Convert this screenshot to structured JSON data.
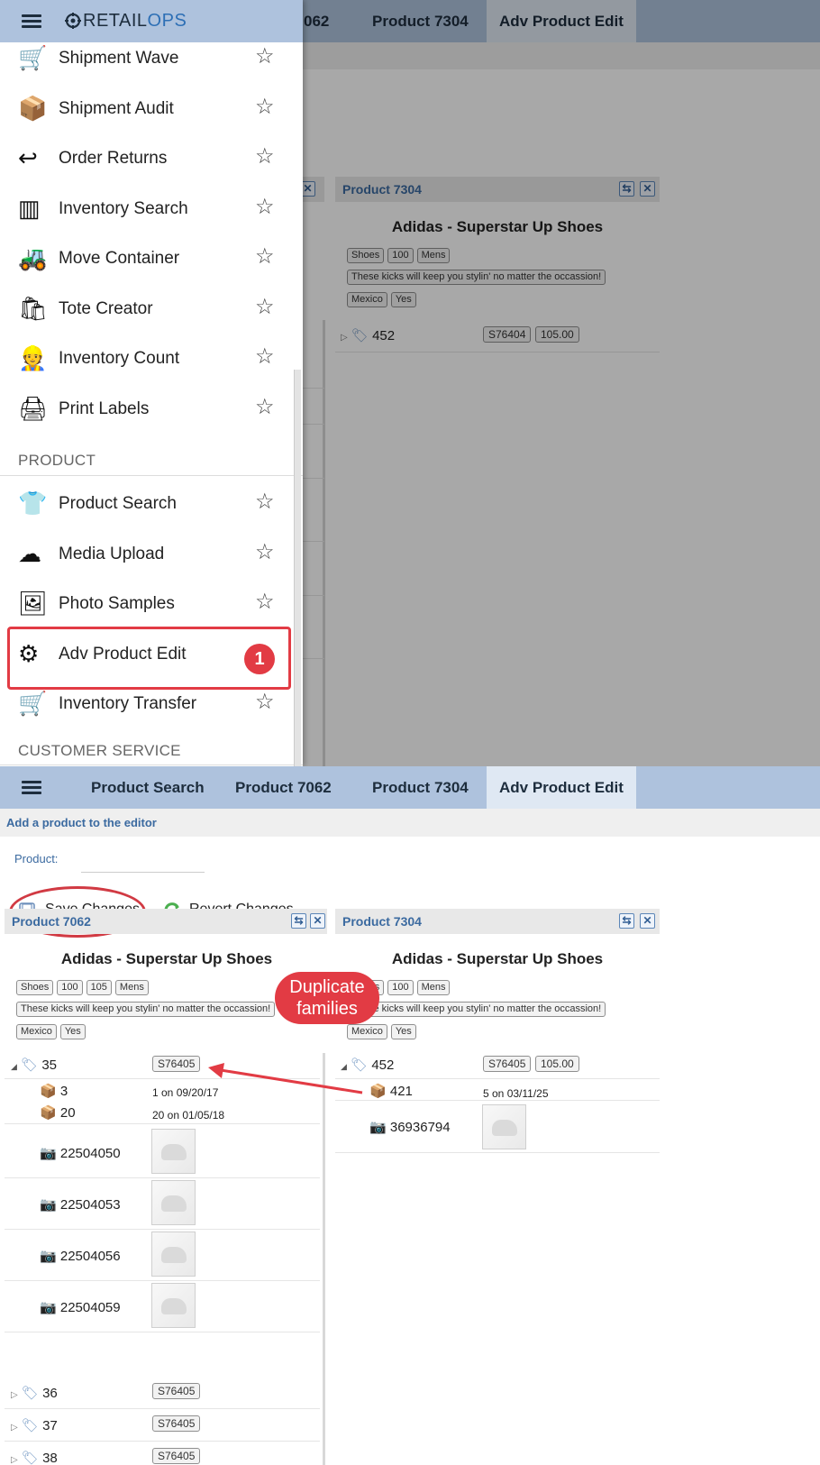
{
  "tabs": [
    "Product Search",
    "Product 7062",
    "Product 7304",
    "Adv Product Edit"
  ],
  "top_partial_tab": "062",
  "logo": {
    "left": "RETAIL",
    "right": "OPS"
  },
  "menu": {
    "items_a": [
      {
        "label": "Shipment Wave",
        "icon": "hand-truck-icon"
      },
      {
        "label": "Shipment Audit",
        "icon": "open-box-icon"
      },
      {
        "label": "Order Returns",
        "icon": "return-box-icon"
      },
      {
        "label": "Inventory Search",
        "icon": "barcode-search-icon"
      },
      {
        "label": "Move Container",
        "icon": "forklift-icon"
      },
      {
        "label": "Tote Creator",
        "icon": "shopping-bags-icon"
      },
      {
        "label": "Inventory Count",
        "icon": "counting-worker-icon"
      },
      {
        "label": "Print Labels",
        "icon": "printer-icon"
      }
    ],
    "section_product": "PRODUCT",
    "items_b": [
      {
        "label": "Product Search",
        "icon": "shirt-search-icon"
      },
      {
        "label": "Media Upload",
        "icon": "cloud-upload-icon"
      },
      {
        "label": "Photo Samples",
        "icon": "photos-icon"
      },
      {
        "label": "Adv Product Edit",
        "icon": "gear-shirt-icon"
      },
      {
        "label": "Inventory Transfer",
        "icon": "hand-truck-icon"
      }
    ],
    "section_cs": "CUSTOMER SERVICE",
    "badge": "1",
    "star": "☆"
  },
  "editor": {
    "hint": "Add a product to the editor",
    "product_label": "Product:",
    "product_value": "",
    "save_label": "Save Changes",
    "revert_label": "Revert Changes",
    "callout": "Duplicate families"
  },
  "left_panel": {
    "header": "Product 7062",
    "title": "Adidas - Superstar Up Shoes",
    "chips1": [
      "Shoes",
      "100",
      "105",
      "Mens"
    ],
    "description": "These kicks will keep you stylin' no matter the occassion!",
    "chips2": [
      "Mexico",
      "Yes"
    ],
    "family": {
      "name": "35",
      "sku": "S76405"
    },
    "stock": [
      {
        "name": "3",
        "note": "1 on 09/20/17"
      },
      {
        "name": "20",
        "note": "20 on 01/05/18"
      }
    ],
    "media": [
      "22504050",
      "22504053",
      "22504056",
      "22504059"
    ],
    "more_families": [
      {
        "name": "36",
        "sku": "S76405"
      },
      {
        "name": "37",
        "sku": "S76405"
      },
      {
        "name": "38",
        "sku": "S76405"
      }
    ]
  },
  "right_panel": {
    "header": "Product 7304",
    "title": "Adidas - Superstar Up Shoes",
    "chips1": [
      "Shoes",
      "100",
      "Mens"
    ],
    "description": "These kicks will keep you stylin' no matter the occassion!",
    "chips2": [
      "Mexico",
      "Yes"
    ],
    "family_top": {
      "name": "452",
      "sku": "S76404",
      "price": "105.00"
    },
    "family": {
      "name": "452",
      "sku": "S76405",
      "price": "105.00"
    },
    "stock": {
      "name": "421",
      "note": "5 on 03/11/25"
    },
    "media": "36936794"
  },
  "colors": {
    "tabbar": "#aec2dd",
    "accent": "#3b6aa0",
    "annotation": "#e23b44"
  }
}
